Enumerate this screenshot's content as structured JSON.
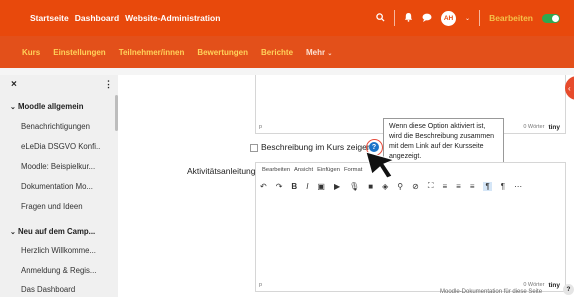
{
  "topnav": {
    "items": [
      "Startseite",
      "Dashboard",
      "Website-Administration"
    ],
    "avatar_initials": "AH",
    "edit_mode_label": "Bearbeiten"
  },
  "coursenav": {
    "tabs": [
      "Kurs",
      "Einstellungen",
      "Teilnehmer/innen",
      "Bewertungen",
      "Berichte",
      "Mehr"
    ]
  },
  "sidebar": {
    "close": "×",
    "menu": "⋮",
    "section1": "Moodle allgemein",
    "items1": [
      "Benachrichtigungen",
      "eLeDia DSGVO Konfi..",
      "Moodle: Beispielkur...",
      "Dokumentation Mo...",
      "Fragen und Ideen"
    ],
    "section2": "Neu auf dem Camp...",
    "items2": [
      "Herzlich Willkomme...",
      "Anmeldung & Regis...",
      "Das Dashboard"
    ]
  },
  "editor1": {
    "path": "p",
    "wordcount": "0 Wörter",
    "brand": "tiny"
  },
  "show_description": {
    "label": "Beschreibung im Kurs zeigen"
  },
  "tooltip": {
    "text": "Wenn diese Option aktiviert ist, wird die Beschreibung zusammen mit dem Link auf der Kursseite angezeigt."
  },
  "activity": {
    "label": "Aktivitätsanleitung",
    "menu": [
      "Bearbeiten",
      "Ansicht",
      "Einfügen",
      "Format"
    ]
  },
  "editor2": {
    "path": "p",
    "wordcount": "0 Wörter",
    "brand": "tiny"
  },
  "footer": {
    "text": "Moodle-Dokumentation für diese Seite"
  },
  "colors": {
    "topbar": "#e8490c",
    "subbar": "#e3501a",
    "tab_active": "#ffd25a",
    "help_icon": "#1a73c9"
  }
}
